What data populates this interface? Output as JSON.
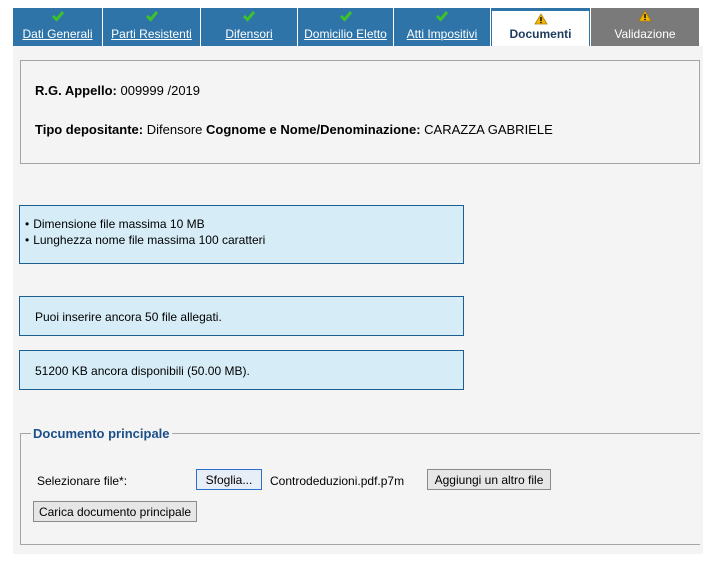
{
  "tabs": [
    {
      "label": "Dati Generali",
      "status": "ok"
    },
    {
      "label": "Parti Resistenti",
      "status": "ok"
    },
    {
      "label": "Difensori",
      "status": "ok"
    },
    {
      "label": "Domicilio Eletto",
      "status": "ok"
    },
    {
      "label": "Atti Impositivi",
      "status": "ok"
    },
    {
      "label": "Documenti",
      "status": "warning",
      "active": true
    },
    {
      "label": "Validazione",
      "status": "warning",
      "disabled": true
    }
  ],
  "header": {
    "rg_label": "R.G. Appello:",
    "rg_value": "009999 /2019",
    "tipo_label": "Tipo depositante:",
    "tipo_value": "Difensore",
    "nome_label": "Cognome e Nome/Denominazione:",
    "nome_value": "CARAZZA GABRIELE"
  },
  "info": {
    "limits": [
      "Dimensione file massima 10 MB",
      "Lunghezza nome file massima 100 caratteri"
    ],
    "remaining_files": "Puoi inserire ancora 50 file allegati.",
    "remaining_space": "51200 KB ancora disponibili (50.00 MB)."
  },
  "document": {
    "legend": "Documento principale",
    "select_label": "Selezionare file*:",
    "browse_label": "Sfoglia...",
    "filename": "Controdeduzioni.pdf.p7m",
    "add_label": "Aggiungi un altro file",
    "upload_label": "Carica documento principale"
  },
  "colors": {
    "tab": "#2e74a9",
    "tab_disabled": "#7a7a7a",
    "info_bg": "#d6edf7",
    "info_border": "#1b5e8f",
    "check": "#3dc22b",
    "warning": "#f2b705"
  }
}
